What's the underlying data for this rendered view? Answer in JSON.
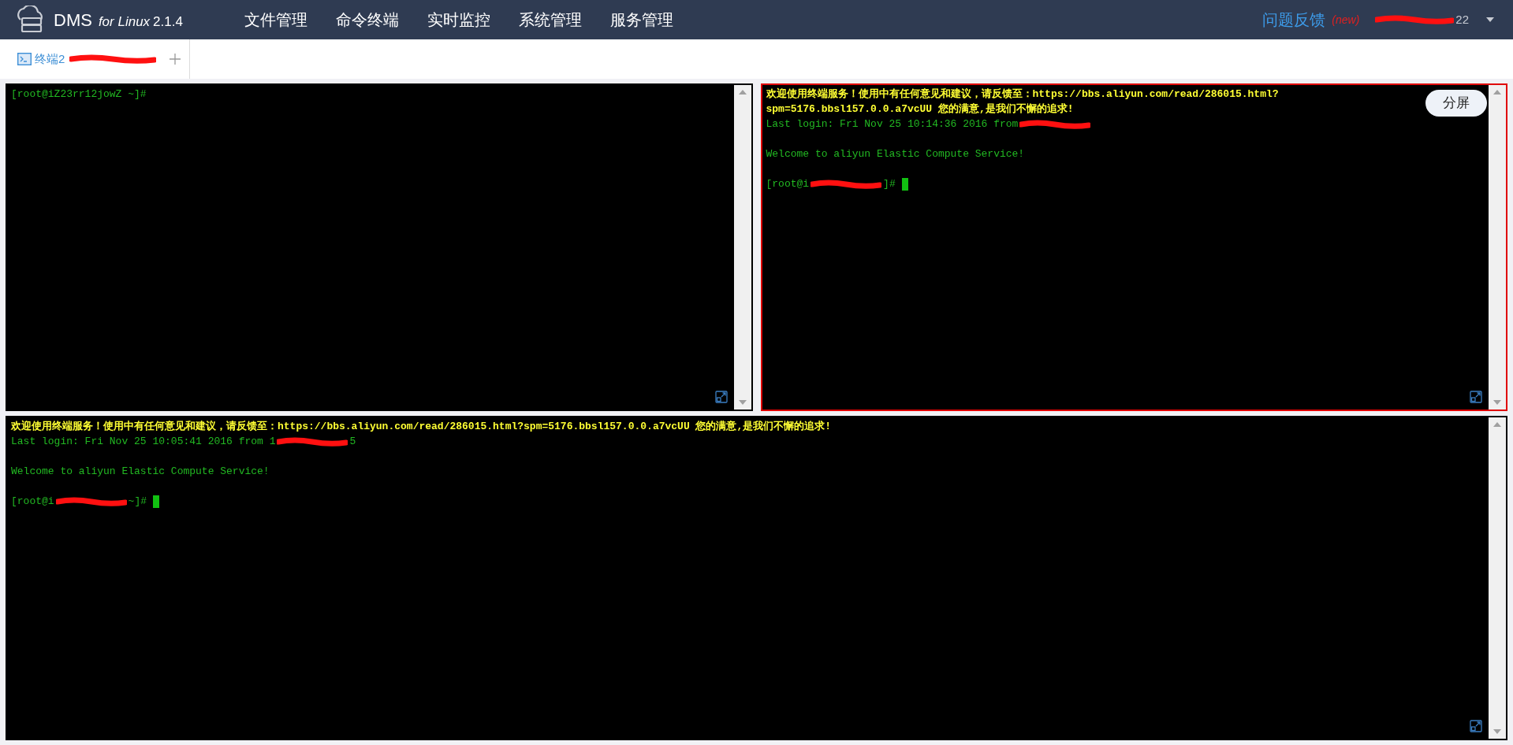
{
  "header": {
    "logo": {
      "name": "DMS",
      "subtitle": "for Linux",
      "version": "2.1.4"
    },
    "nav": [
      {
        "label": "文件管理"
      },
      {
        "label": "命令终端"
      },
      {
        "label": "实时监控"
      },
      {
        "label": "系统管理"
      },
      {
        "label": "服务管理"
      }
    ],
    "feedback": "问题反馈",
    "feedback_badge": "(new)",
    "user_tail": "22"
  },
  "tabs": [
    {
      "label": "终端2",
      "selected": true
    }
  ],
  "split_button": "分屏",
  "terminals": [
    {
      "selected": false,
      "lines": [
        {
          "kind": "prompt",
          "text": "[root@iZ23rr12jowZ ~]#",
          "cursor": false
        }
      ]
    },
    {
      "selected": true,
      "lines": [
        {
          "kind": "notice",
          "text": "欢迎使用终端服务！使用中有任何意见和建议，请反馈至：https://bbs.aliyun.com/read/286015.html?spm=5176.bbsl157.0.0.a7vcUU 您的满意,是我们不懈的追求!"
        },
        {
          "kind": "output",
          "text": "Last login: Fri Nov 25 10:14:36 2016 from",
          "redacted": true
        },
        {
          "kind": "blank"
        },
        {
          "kind": "output",
          "text": "Welcome to aliyun Elastic Compute Service!"
        },
        {
          "kind": "blank"
        },
        {
          "kind": "prompt",
          "text": "[root@i",
          "redacted": true,
          "tail": "]#",
          "cursor": true
        }
      ]
    },
    {
      "selected": false,
      "lines": [
        {
          "kind": "notice",
          "text": "欢迎使用终端服务！使用中有任何意见和建议，请反馈至：https://bbs.aliyun.com/read/286015.html?spm=5176.bbsl157.0.0.a7vcUU 您的满意,是我们不懈的追求!"
        },
        {
          "kind": "output",
          "text": "Last login: Fri Nov 25 10:05:41 2016 from 1",
          "redacted": true,
          "tail": "5"
        },
        {
          "kind": "blank"
        },
        {
          "kind": "output",
          "text": "Welcome to aliyun Elastic Compute Service!"
        },
        {
          "kind": "blank"
        },
        {
          "kind": "prompt",
          "text": "[root@i",
          "redacted": true,
          "tail": "~]#",
          "cursor": true
        }
      ]
    }
  ]
}
